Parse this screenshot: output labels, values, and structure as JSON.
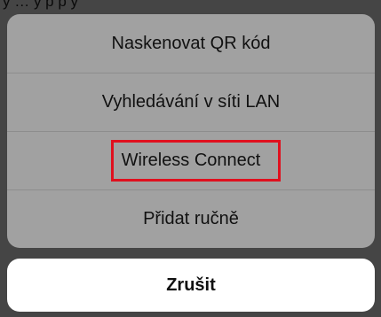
{
  "backdrop": {
    "partial_text": "y  …   y p   p y   "
  },
  "action_sheet": {
    "items": [
      {
        "label": "Naskenovat QR kód"
      },
      {
        "label": "Vyhledávání v síti LAN"
      },
      {
        "label": "Wireless Connect",
        "highlighted": true
      },
      {
        "label": "Přidat ručně"
      }
    ],
    "cancel_label": "Zrušit"
  },
  "colors": {
    "overlay": "#454545",
    "group_background": "#a1a1a1",
    "separator": "#8d8d8d",
    "highlight_border": "#e0101e",
    "cancel_background": "#ffffff"
  }
}
